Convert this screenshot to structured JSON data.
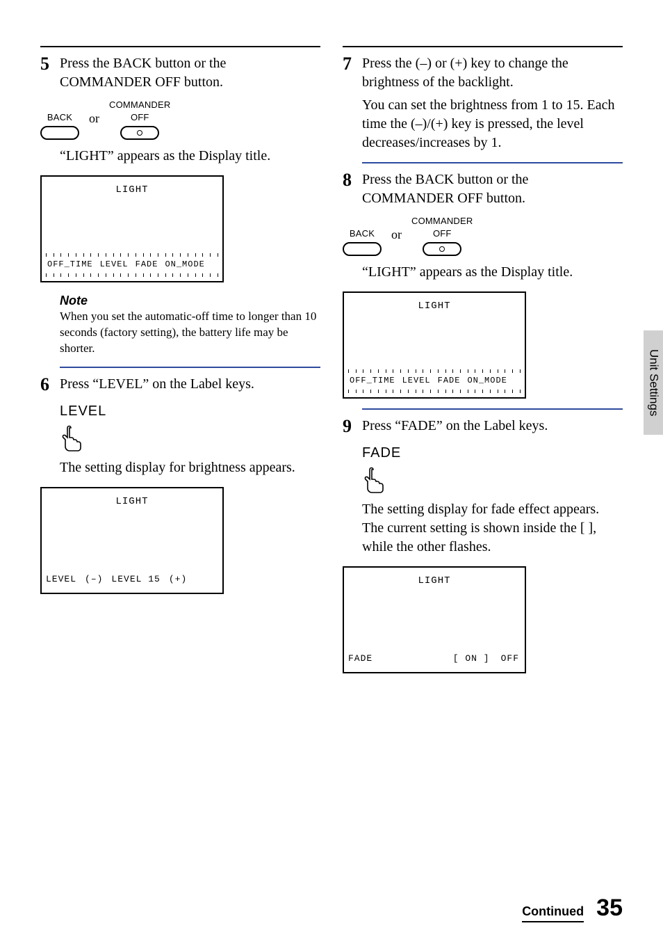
{
  "side_tab": "Unit Settings",
  "footer": {
    "continued": "Continued",
    "page": "35"
  },
  "buttons": {
    "back": "BACK",
    "commander_off": "COMMANDER\nOFF",
    "or": "or"
  },
  "lcd": {
    "title": "LIGHT",
    "tabs": {
      "off_time": "OFF_TIME",
      "level": "LEVEL",
      "fade": "FADE",
      "on_mode": "ON_MODE"
    },
    "level_row": {
      "label": "LEVEL",
      "minus": "(–)",
      "value": "LEVEL 15",
      "plus": "(+)"
    },
    "fade_row": {
      "label": "FADE",
      "on": "[ ON ]",
      "off": "OFF"
    }
  },
  "label_keys": {
    "level": "LEVEL",
    "fade": "FADE"
  },
  "step5": {
    "text": "Press the BACK button or the COMMANDER OFF button.",
    "after": "“LIGHT” appears as the Display title.",
    "note_h": "Note",
    "note_b": "When you set the automatic-off time to longer than 10 seconds (factory setting), the battery life may be shorter."
  },
  "step6": {
    "text": "Press “LEVEL” on the Label keys.",
    "after": "The setting display for brightness appears."
  },
  "step7": {
    "text": "Press the (–) or (+) key to change the brightness of the backlight.",
    "after": "You can set the brightness from 1 to 15. Each time the (–)/(+) key is pressed, the level decreases/increases by 1."
  },
  "step8": {
    "text": "Press the BACK button or the COMMANDER OFF button.",
    "after": "“LIGHT” appears as the Display title."
  },
  "step9": {
    "text": "Press “FADE” on the Label keys.",
    "after1": "The setting display for fade effect appears.",
    "after2": "The current setting is shown inside the [ ], while the other flashes."
  }
}
